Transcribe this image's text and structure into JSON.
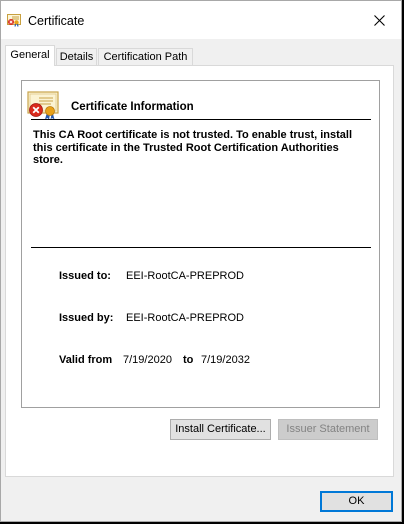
{
  "window": {
    "title": "Certificate",
    "close_symbol": "✕"
  },
  "tabs": [
    {
      "label": "General",
      "active": true
    },
    {
      "label": "Details",
      "active": false
    },
    {
      "label": "Certification Path",
      "active": false
    }
  ],
  "info": {
    "heading": "Certificate Information",
    "warning": "This CA Root certificate is not trusted. To enable trust, install this certificate in the Trusted Root Certification Authorities store.",
    "icon": "certificate-error-icon"
  },
  "fields": {
    "issued_to_label": "Issued to:",
    "issued_to_value": "EEI-RootCA-PREPROD",
    "issued_by_label": "Issued by:",
    "issued_by_value": "EEI-RootCA-PREPROD",
    "valid_from_label": "Valid from",
    "valid_from_value": "7/19/2020",
    "valid_to_label": "to",
    "valid_to_value": "7/19/2032"
  },
  "buttons": {
    "install": "Install Certificate...",
    "issuer_statement": "Issuer Statement",
    "ok": "OK"
  },
  "colors": {
    "accent": "#0078d7",
    "error_red": "#d9291c"
  }
}
